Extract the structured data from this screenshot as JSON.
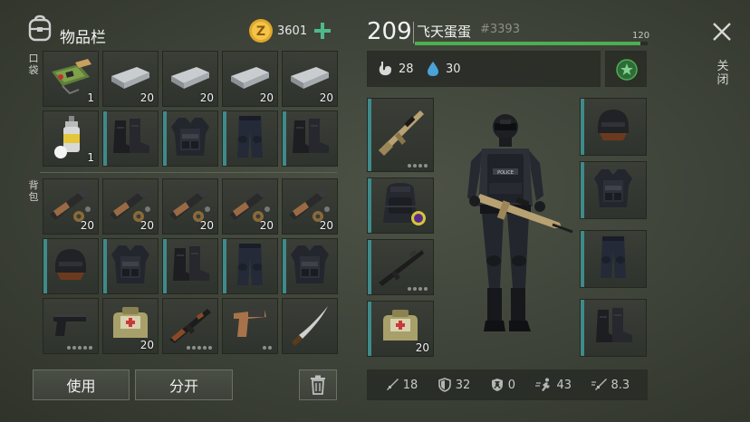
{
  "inventory": {
    "title": "物品栏",
    "pocket_label": "口袋",
    "backpack_label": "背包",
    "coins": "3601",
    "pocket": [
      {
        "icon": "circuit-board-icon",
        "count": "1",
        "quality": false
      },
      {
        "icon": "metal-bar-icon",
        "count": "20",
        "quality": false
      },
      {
        "icon": "metal-bar-icon",
        "count": "20",
        "quality": false
      },
      {
        "icon": "metal-bar-icon",
        "count": "20",
        "quality": false
      },
      {
        "icon": "metal-bar-icon",
        "count": "20",
        "quality": false
      },
      {
        "icon": "spray-can-icon",
        "count": "1",
        "quality": false
      },
      {
        "icon": "boots-icon",
        "count": "",
        "quality": true
      },
      {
        "icon": "vest-icon",
        "count": "",
        "quality": true
      },
      {
        "icon": "pants-icon",
        "count": "",
        "quality": true
      },
      {
        "icon": "boots-icon",
        "count": "",
        "quality": true
      }
    ],
    "backpack": [
      {
        "icon": "weapon-parts-icon",
        "count": "20",
        "quality": false
      },
      {
        "icon": "weapon-parts-icon",
        "count": "20",
        "quality": false
      },
      {
        "icon": "weapon-parts-icon",
        "count": "20",
        "quality": false
      },
      {
        "icon": "weapon-parts-icon",
        "count": "20",
        "quality": false
      },
      {
        "icon": "weapon-parts-icon",
        "count": "20",
        "quality": false
      },
      {
        "icon": "helmet-icon",
        "count": "",
        "quality": true
      },
      {
        "icon": "vest-icon",
        "count": "",
        "quality": true
      },
      {
        "icon": "boots-icon",
        "count": "",
        "quality": true
      },
      {
        "icon": "pants-icon",
        "count": "",
        "quality": true
      },
      {
        "icon": "vest-icon",
        "count": "",
        "quality": true
      },
      {
        "icon": "pistol-icon",
        "count": "",
        "quality": false,
        "dots": 5
      },
      {
        "icon": "medkit-icon",
        "count": "20",
        "quality": false
      },
      {
        "icon": "ak-rifle-icon",
        "count": "",
        "quality": false,
        "dots": 5
      },
      {
        "icon": "flare-gun-icon",
        "count": "",
        "quality": false,
        "dots": 2
      },
      {
        "icon": "machete-icon",
        "count": "",
        "quality": false
      }
    ],
    "use_button": "使用",
    "split_button": "分开"
  },
  "character": {
    "level": "209",
    "name": "飞天蛋蛋",
    "tag": "#3393",
    "xp_max": "120",
    "xp_progress": 0.97,
    "food": "28",
    "water": "30",
    "slots_left": [
      {
        "icon": "assault-rifle-icon",
        "count": "",
        "dots": 4
      },
      {
        "icon": "backpack-icon",
        "count": ""
      },
      {
        "icon": "rifle-icon",
        "count": "",
        "dots": 4
      },
      {
        "icon": "medkit-icon",
        "count": "20"
      }
    ],
    "slots_right": [
      {
        "icon": "helmet-icon"
      },
      {
        "icon": "vest-icon"
      },
      {
        "icon": "pants-icon"
      },
      {
        "icon": "boots-icon"
      }
    ],
    "stats": {
      "attack": "18",
      "defense": "32",
      "radiation": "0",
      "speed": "43",
      "stealth": "8.3"
    }
  },
  "close_label": "关闭",
  "colors": {
    "accent_green": "#4caf50",
    "quality_teal": "#3f8a8a",
    "coin_gold": "#e0a82a"
  }
}
